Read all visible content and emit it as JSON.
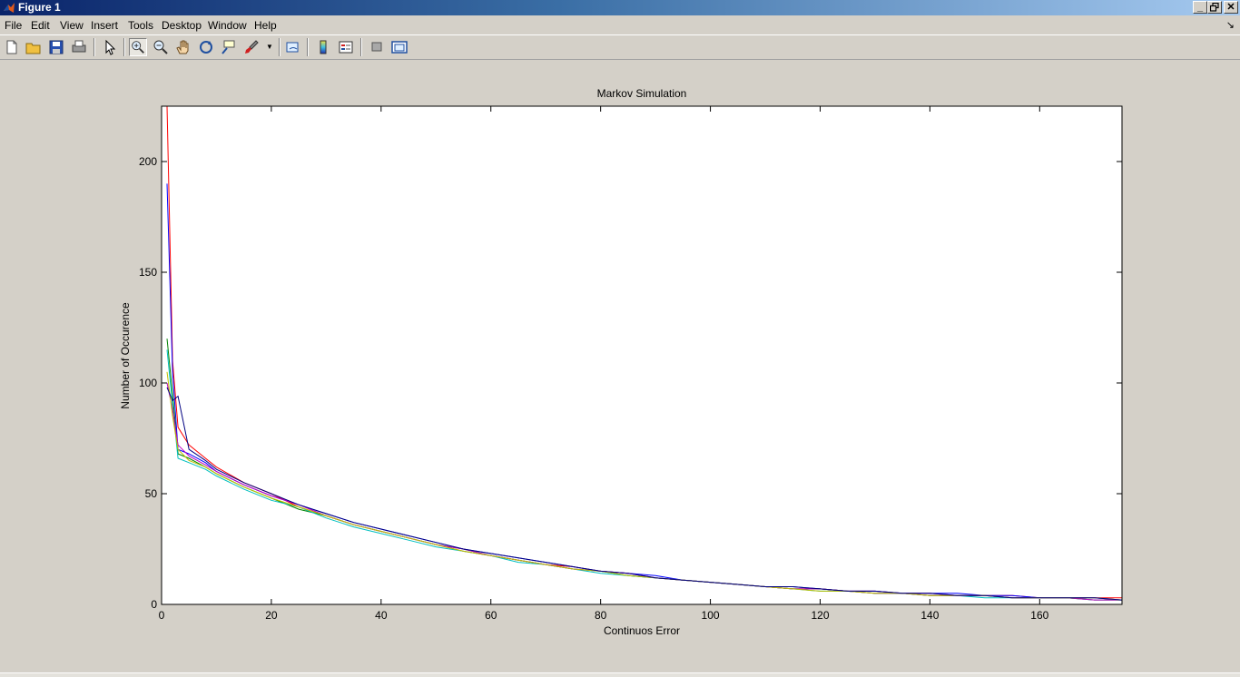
{
  "window": {
    "title": "Figure 1"
  },
  "menu": {
    "items": [
      "File",
      "Edit",
      "View",
      "Insert",
      "Tools",
      "Desktop",
      "Window",
      "Help"
    ]
  },
  "toolbar": {
    "buttons": [
      "new-figure",
      "open-file",
      "save-figure",
      "print-figure",
      "edit-plot",
      "zoom-in",
      "zoom-out",
      "pan",
      "rotate-3d",
      "data-cursor",
      "brush",
      "link-plot",
      "insert-colorbar",
      "insert-legend",
      "hide-plot-tools",
      "show-plot-tools"
    ]
  },
  "colors": {
    "series": [
      "#0000ff",
      "#008000",
      "#ff0000",
      "#00bfbf",
      "#bf00bf",
      "#bfbf00",
      "#000080"
    ]
  },
  "chart_data": {
    "type": "line",
    "title": "Markov Simulation",
    "xlabel": "Continuos Error",
    "ylabel": "Number of Occurence",
    "xlim": [
      0,
      175
    ],
    "ylim": [
      0,
      225
    ],
    "xticks": [
      0,
      20,
      40,
      60,
      80,
      100,
      120,
      140,
      160
    ],
    "yticks": [
      0,
      50,
      100,
      150,
      200
    ],
    "grid": false,
    "legend": "none",
    "x": [
      1,
      2,
      3,
      5,
      8,
      10,
      15,
      20,
      25,
      30,
      35,
      40,
      45,
      50,
      55,
      60,
      65,
      70,
      75,
      80,
      85,
      90,
      95,
      100,
      105,
      110,
      115,
      120,
      125,
      130,
      135,
      140,
      145,
      150,
      155,
      160,
      165,
      170,
      175
    ],
    "series": [
      {
        "color": "#ff0000",
        "values": [
          225,
          110,
          80,
          72,
          66,
          62,
          55,
          50,
          44,
          40,
          36,
          33,
          30,
          27,
          24,
          22,
          20,
          18,
          17,
          15,
          14,
          12,
          11,
          10,
          9,
          8,
          7,
          7,
          6,
          6,
          5,
          5,
          4,
          4,
          4,
          3,
          3,
          3,
          3
        ]
      },
      {
        "color": "#0000ff",
        "values": [
          190,
          105,
          70,
          68,
          64,
          60,
          54,
          49,
          45,
          41,
          37,
          34,
          31,
          28,
          25,
          23,
          21,
          19,
          17,
          15,
          14,
          13,
          11,
          10,
          9,
          8,
          8,
          7,
          6,
          6,
          5,
          5,
          5,
          4,
          4,
          3,
          3,
          3,
          2
        ]
      },
      {
        "color": "#008000",
        "values": [
          120,
          95,
          68,
          66,
          62,
          59,
          53,
          48,
          43,
          40,
          36,
          33,
          30,
          27,
          25,
          22,
          20,
          18,
          16,
          15,
          13,
          12,
          11,
          10,
          9,
          8,
          7,
          7,
          6,
          5,
          5,
          4,
          4,
          4,
          3,
          3,
          3,
          2,
          2
        ]
      },
      {
        "color": "#00bfbf",
        "values": [
          115,
          90,
          66,
          64,
          61,
          58,
          52,
          47,
          44,
          39,
          35,
          32,
          29,
          26,
          24,
          22,
          19,
          18,
          16,
          14,
          13,
          12,
          11,
          10,
          9,
          8,
          7,
          6,
          6,
          5,
          5,
          4,
          4,
          3,
          3,
          3,
          3,
          2,
          2
        ]
      },
      {
        "color": "#bf00bf",
        "values": [
          100,
          88,
          72,
          67,
          63,
          60,
          54,
          49,
          45,
          40,
          36,
          33,
          30,
          27,
          25,
          22,
          20,
          18,
          16,
          15,
          14,
          12,
          11,
          10,
          9,
          8,
          7,
          7,
          6,
          5,
          5,
          4,
          4,
          4,
          3,
          3,
          3,
          2,
          2
        ]
      },
      {
        "color": "#bfbf00",
        "values": [
          105,
          85,
          70,
          65,
          62,
          59,
          53,
          48,
          44,
          40,
          36,
          33,
          30,
          27,
          24,
          22,
          20,
          18,
          16,
          15,
          13,
          12,
          11,
          10,
          9,
          8,
          7,
          6,
          6,
          5,
          5,
          4,
          4,
          4,
          3,
          3,
          3,
          3,
          2
        ]
      },
      {
        "color": "#000080",
        "values": [
          98,
          92,
          94,
          70,
          65,
          61,
          55,
          50,
          45,
          41,
          37,
          34,
          31,
          28,
          25,
          23,
          21,
          19,
          17,
          15,
          14,
          12,
          11,
          10,
          9,
          8,
          8,
          7,
          6,
          6,
          5,
          5,
          4,
          4,
          3,
          3,
          3,
          3,
          2
        ]
      }
    ]
  }
}
